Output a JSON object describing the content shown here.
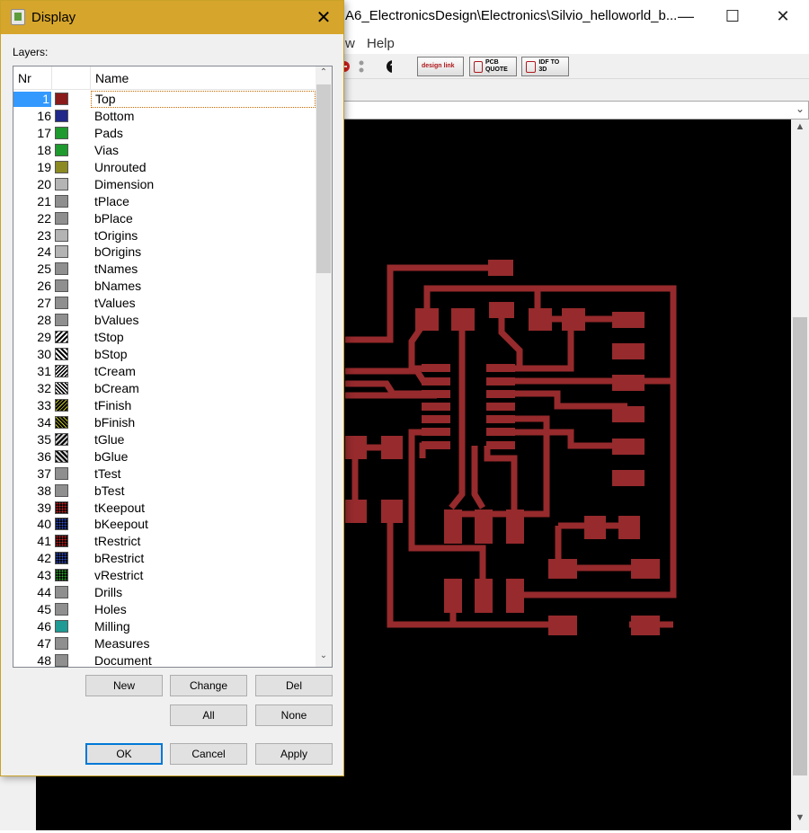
{
  "background_window": {
    "title": "A6_ElectronicsDesign\\Electronics\\Silvio_helloworld_b...",
    "menu": [
      "w",
      "Help"
    ],
    "toolbar_buttons": [
      {
        "label": "design link",
        "icon": "design-link-icon"
      },
      {
        "label": "PCB QUOTE",
        "icon": "pcb-quote-icon"
      },
      {
        "label": "IDF TO 3D",
        "icon": "idf-to-3d-icon"
      }
    ],
    "window_buttons": {
      "minimize": "—",
      "maximize": "☐",
      "close": "✕"
    }
  },
  "dialog": {
    "title": "Display",
    "close": "✕",
    "layers_label": "Layers:",
    "columns": {
      "nr": "Nr",
      "name": "Name"
    },
    "layers": [
      {
        "nr": "1",
        "name": "Top",
        "color": "#8b1a1a",
        "selected": true
      },
      {
        "nr": "16",
        "name": "Bottom",
        "color": "#20288a"
      },
      {
        "nr": "17",
        "name": "Pads",
        "color": "#1f9a2e"
      },
      {
        "nr": "18",
        "name": "Vias",
        "color": "#1f9a2e"
      },
      {
        "nr": "19",
        "name": "Unrouted",
        "color": "#8c8a22"
      },
      {
        "nr": "20",
        "name": "Dimension",
        "color": "#b4b4b4"
      },
      {
        "nr": "21",
        "name": "tPlace",
        "color": "#8f8f8f"
      },
      {
        "nr": "22",
        "name": "bPlace",
        "color": "#8f8f8f"
      },
      {
        "nr": "23",
        "name": "tOrigins",
        "color": "#b4b4b4"
      },
      {
        "nr": "24",
        "name": "bOrigins",
        "color": "#b4b4b4"
      },
      {
        "nr": "25",
        "name": "tNames",
        "color": "#8f8f8f"
      },
      {
        "nr": "26",
        "name": "bNames",
        "color": "#8f8f8f"
      },
      {
        "nr": "27",
        "name": "tValues",
        "color": "#8f8f8f"
      },
      {
        "nr": "28",
        "name": "bValues",
        "color": "#8f8f8f"
      },
      {
        "nr": "29",
        "name": "tStop",
        "color": "#000000",
        "pattern": "hatch"
      },
      {
        "nr": "30",
        "name": "bStop",
        "color": "#000000",
        "pattern": "hatch-back"
      },
      {
        "nr": "31",
        "name": "tCream",
        "color": "#000000",
        "pattern": "hatch-dense"
      },
      {
        "nr": "32",
        "name": "bCream",
        "color": "#000000",
        "pattern": "hatch-back-dense"
      },
      {
        "nr": "33",
        "name": "tFinish",
        "color": "#000000",
        "pattern": "hatch-yellow"
      },
      {
        "nr": "34",
        "name": "bFinish",
        "color": "#000000",
        "pattern": "hatch-back-yellow"
      },
      {
        "nr": "35",
        "name": "tGlue",
        "color": "#000000",
        "pattern": "hatch-light"
      },
      {
        "nr": "36",
        "name": "bGlue",
        "color": "#000000",
        "pattern": "hatch-back-light"
      },
      {
        "nr": "37",
        "name": "tTest",
        "color": "#8f8f8f"
      },
      {
        "nr": "38",
        "name": "bTest",
        "color": "#8f8f8f"
      },
      {
        "nr": "39",
        "name": "tKeepout",
        "color": "#000000",
        "pattern": "dots-red"
      },
      {
        "nr": "40",
        "name": "bKeepout",
        "color": "#000000",
        "pattern": "dots-blue"
      },
      {
        "nr": "41",
        "name": "tRestrict",
        "color": "#000000",
        "pattern": "dots-red"
      },
      {
        "nr": "42",
        "name": "bRestrict",
        "color": "#000000",
        "pattern": "dots-blue"
      },
      {
        "nr": "43",
        "name": "vRestrict",
        "color": "#000000",
        "pattern": "dots-green"
      },
      {
        "nr": "44",
        "name": "Drills",
        "color": "#8f8f8f"
      },
      {
        "nr": "45",
        "name": "Holes",
        "color": "#8f8f8f"
      },
      {
        "nr": "46",
        "name": "Milling",
        "color": "#1f9a95"
      },
      {
        "nr": "47",
        "name": "Measures",
        "color": "#8f8f8f"
      },
      {
        "nr": "48",
        "name": "Document",
        "color": "#8f8f8f"
      }
    ],
    "buttons": {
      "new": "New",
      "change": "Change",
      "del": "Del",
      "all": "All",
      "none": "None",
      "ok": "OK",
      "cancel": "Cancel",
      "apply": "Apply"
    }
  },
  "pcb_colors": {
    "trace": "#962a2c",
    "canvas": "#000000"
  }
}
